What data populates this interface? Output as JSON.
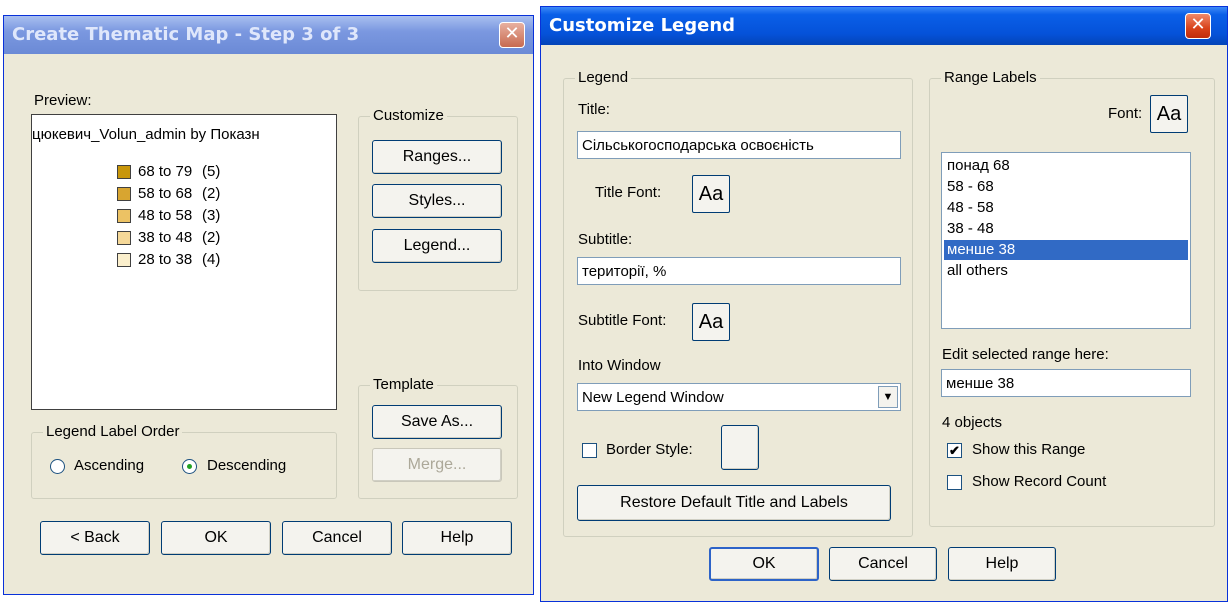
{
  "wizard": {
    "title": "Create Thematic Map - Step 3 of 3",
    "close": "✕",
    "preview_label": "Preview:",
    "preview_title": "цюкевич_Volun_admin by Показн",
    "legend_rows": [
      {
        "label": "68 to 79",
        "count": "(5)",
        "color": "#c8960a"
      },
      {
        "label": "58 to 68",
        "count": "(2)",
        "color": "#d8a530"
      },
      {
        "label": "48 to 58",
        "count": "(3)",
        "color": "#ecc264"
      },
      {
        "label": "38 to 48",
        "count": "(2)",
        "color": "#f5d898"
      },
      {
        "label": "28 to 38",
        "count": "(4)",
        "color": "#fbefcc"
      }
    ],
    "customize_group": "Customize",
    "ranges_btn": "Ranges...",
    "styles_btn": "Styles...",
    "legend_btn": "Legend...",
    "template_group": "Template",
    "save_as_btn": "Save As...",
    "merge_btn": "Merge...",
    "order_group": "Legend Label Order",
    "ascending": "Ascending",
    "descending": "Descending",
    "back_btn": "< Back",
    "ok_btn": "OK",
    "cancel_btn": "Cancel",
    "help_btn": "Help"
  },
  "legend_dialog": {
    "title": "Customize Legend",
    "close": "✕",
    "legend_group": "Legend",
    "title_label": "Title:",
    "title_value": "Сільськогосподарська освоєність",
    "title_font_label": "Title Font:",
    "font_sample": "Aa",
    "subtitle_label": "Subtitle:",
    "subtitle_value": "території, %",
    "subtitle_font_label": "Subtitle Font:",
    "into_window_label": "Into Window",
    "into_window_value": "New Legend Window",
    "dropdown_arrow": "▼",
    "border_style_label": "Border Style:",
    "restore_btn": "Restore Default Title and Labels",
    "range_group": "Range Labels",
    "font_label": "Font:",
    "range_items": [
      "понад 68",
      "58 - 68",
      "48 - 58",
      "38 - 48",
      "менше 38",
      "all others"
    ],
    "edit_label": "Edit selected range here:",
    "edit_value": "менше 38",
    "objects_count": "4 objects",
    "show_range": "Show this Range",
    "show_range_check": "✔",
    "show_count": "Show Record Count",
    "ok_btn": "OK",
    "cancel_btn": "Cancel",
    "help_btn": "Help"
  }
}
